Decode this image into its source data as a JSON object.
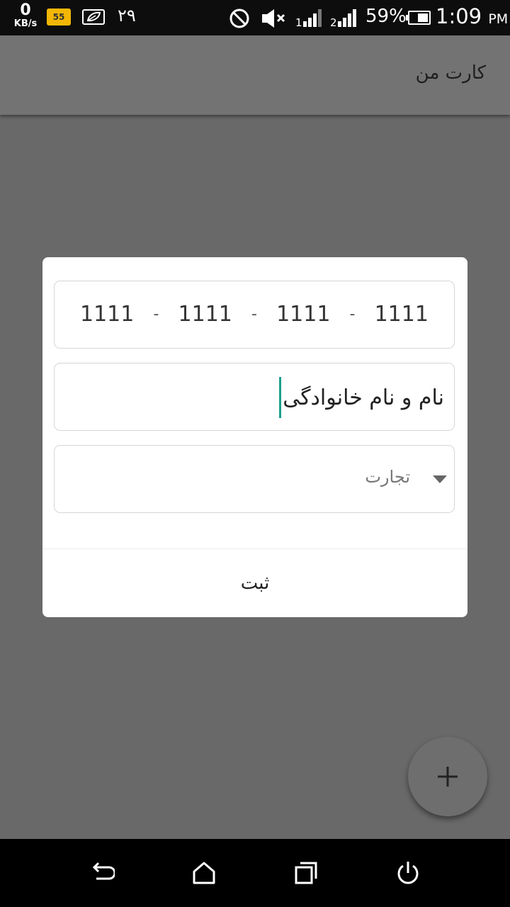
{
  "status_bar": {
    "speed_value": "0",
    "speed_unit": "KB/s",
    "badge_text": "55",
    "notif_number": "۲۹",
    "battery_percent": "59%",
    "time": "1:09",
    "ampm": "PM"
  },
  "app_bar": {
    "title": "کارت من"
  },
  "dialog": {
    "card_number": [
      "1111",
      "1111",
      "1111",
      "1111"
    ],
    "separator": "-",
    "name_value": "نام و نام خانوادگی",
    "category_value": "تجارت",
    "submit_label": "ثبت"
  },
  "colors": {
    "accent_cursor": "#1aa08e",
    "overlay": "#696969",
    "dialog_bg": "#ffffff"
  }
}
